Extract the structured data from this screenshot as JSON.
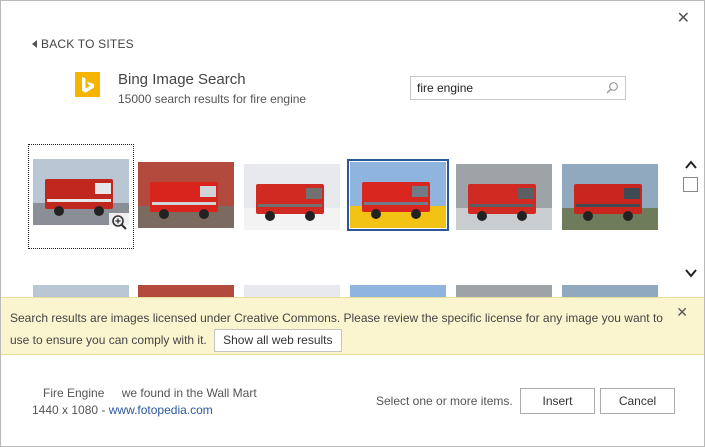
{
  "nav": {
    "back_label": "BACK TO SITES"
  },
  "header": {
    "title": "Bing Image Search",
    "subtitle": "15000 search results for fire engine"
  },
  "search": {
    "value": "fire engine",
    "placeholder": ""
  },
  "results": {
    "thumbnails": [
      {
        "name": "fire-engine-ladder-truck",
        "colors": [
          "#b9c6d3",
          "#c0281f",
          "#8a8f97",
          "#e5e7ea"
        ],
        "state": "focused"
      },
      {
        "name": "fire-engine-red-front",
        "colors": [
          "#b24a3e",
          "#d8241c",
          "#7b6a5f",
          "#cfd4d8"
        ],
        "state": "normal"
      },
      {
        "name": "fire-engine-scania",
        "colors": [
          "#e7e9ec",
          "#d12a23",
          "#f3f3f3",
          "#717171"
        ],
        "state": "normal"
      },
      {
        "name": "fire-engine-yellow-stripe",
        "colors": [
          "#8fb4de",
          "#d9261e",
          "#f2c214",
          "#6f7b86"
        ],
        "state": "selected"
      },
      {
        "name": "fire-engine-depot",
        "colors": [
          "#9ea3a7",
          "#d12a23",
          "#c9cdd0",
          "#5b5f62"
        ],
        "state": "normal"
      },
      {
        "name": "fire-engine-vintage",
        "colors": [
          "#91a9bf",
          "#c8261f",
          "#6f7c5c",
          "#3e4b55"
        ],
        "state": "normal"
      }
    ]
  },
  "notice": {
    "text": "Search results are images licensed under Creative Commons. Please review the specific license for any image you want to use to ensure you can comply with it.",
    "button_label": "Show all web results"
  },
  "footer": {
    "image_name": "Fire Engine",
    "image_desc": "we found in the Wall Mart",
    "image_size": "1440 x 1080 - ",
    "image_source": "www.fotopedia.com",
    "hint": "Select one or more items.",
    "insert_label": "Insert",
    "cancel_label": "Cancel"
  },
  "colors": {
    "accent": "#2b579a",
    "bing": "#f4b400",
    "notice_bg": "#fbf5cf"
  }
}
